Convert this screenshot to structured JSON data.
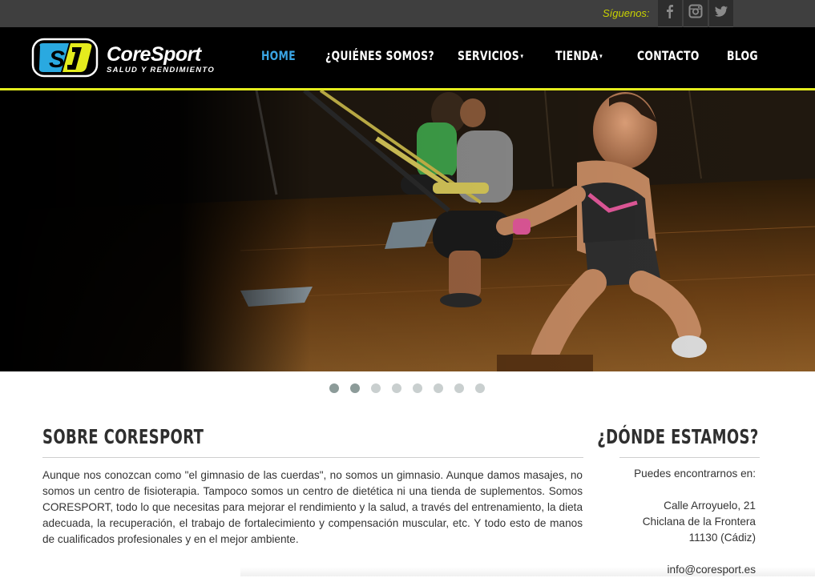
{
  "topbar": {
    "follow_label": "Síguenos:",
    "social": [
      {
        "icon": "facebook-icon"
      },
      {
        "icon": "instagram-icon"
      },
      {
        "icon": "twitter-icon"
      }
    ]
  },
  "brand": {
    "name": "CoreSport",
    "tagline": "SALUD Y RENDIMIENTO",
    "mark": "S"
  },
  "nav": {
    "items": [
      {
        "label": "HOME",
        "active": true
      },
      {
        "label": "¿QUIÉNES SOMOS?",
        "active": false
      },
      {
        "label": "SERVICIOS",
        "active": false,
        "dropdown": true
      },
      {
        "label": "TIENDA",
        "active": false,
        "dropdown": true
      },
      {
        "label": "CONTACTO",
        "active": false
      },
      {
        "label": "BLOG",
        "active": false
      }
    ]
  },
  "slider": {
    "slide_count": 8,
    "active_indices": [
      0,
      1
    ]
  },
  "about": {
    "title": "SOBRE CORESPORT",
    "text": "Aunque nos conozcan como \"el gimnasio de las cuerdas\", no somos un gimnasio. Aunque damos masajes, no somos un centro de fisioterapia. Tampoco somos un centro de dietética ni una tienda de suplementos. Somos CORESPORT, todo lo que necesitas para mejorar el rendimiento y la salud, a través del entrenamiento, la dieta adecuada, la recuperación, el trabajo de fortalecimiento y compensación muscular, etc. Y todo esto de manos de cualificados profesionales y en el mejor ambiente."
  },
  "location": {
    "title": "¿DÓNDE ESTAMOS?",
    "intro": "Puedes encontrarnos en:",
    "street": "Calle Arroyuelo, 21",
    "city": "Chiclana de la Frontera",
    "postal": "11130 (Cádiz)",
    "email": "info@coresport.es"
  },
  "colors": {
    "accent_yellow": "#e4ec1d",
    "nav_active": "#3aa4e3",
    "topbar_bg": "#3f3f3f",
    "header_bg": "#000000"
  }
}
